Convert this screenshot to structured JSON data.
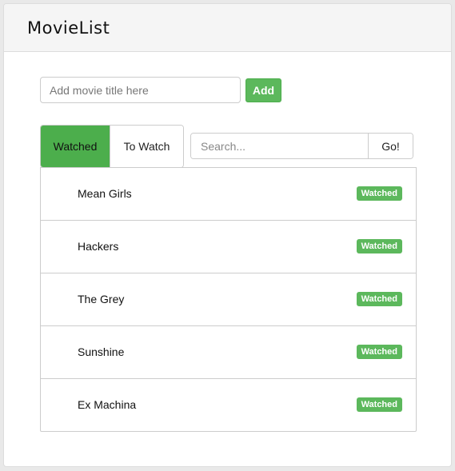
{
  "app": {
    "title": "MovieList"
  },
  "add_form": {
    "placeholder": "Add movie title here",
    "value": "",
    "button_label": "Add"
  },
  "tabs": [
    {
      "label": "Watched",
      "active": true
    },
    {
      "label": "To Watch",
      "active": false
    }
  ],
  "search": {
    "placeholder": "Search...",
    "value": "",
    "button_label": "Go!"
  },
  "movies": [
    {
      "title": "Mean Girls",
      "status": "Watched"
    },
    {
      "title": "Hackers",
      "status": "Watched"
    },
    {
      "title": "The Grey",
      "status": "Watched"
    },
    {
      "title": "Sunshine",
      "status": "Watched"
    },
    {
      "title": "Ex Machina",
      "status": "Watched"
    }
  ],
  "colors": {
    "accent": "#5cb85c",
    "active_tab": "#4cae4c",
    "header_bg": "#f5f5f5",
    "border": "#cccccc"
  }
}
